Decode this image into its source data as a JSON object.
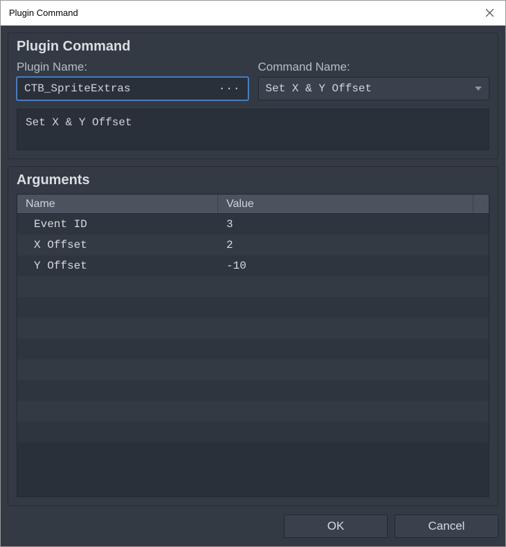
{
  "window": {
    "title": "Plugin Command"
  },
  "pluginCommand": {
    "groupTitle": "Plugin Command",
    "pluginNameLabel": "Plugin Name:",
    "pluginNameValue": "CTB_SpriteExtras",
    "commandNameLabel": "Command Name:",
    "commandNameValue": "Set X & Y Offset",
    "description": "Set X & Y Offset"
  },
  "arguments": {
    "groupTitle": "Arguments",
    "headers": {
      "name": "Name",
      "value": "Value"
    },
    "rows": [
      {
        "name": "Event ID",
        "value": "3"
      },
      {
        "name": "X Offset",
        "value": "2"
      },
      {
        "name": "Y Offset",
        "value": "-10"
      }
    ]
  },
  "buttons": {
    "ok": "OK",
    "cancel": "Cancel"
  }
}
